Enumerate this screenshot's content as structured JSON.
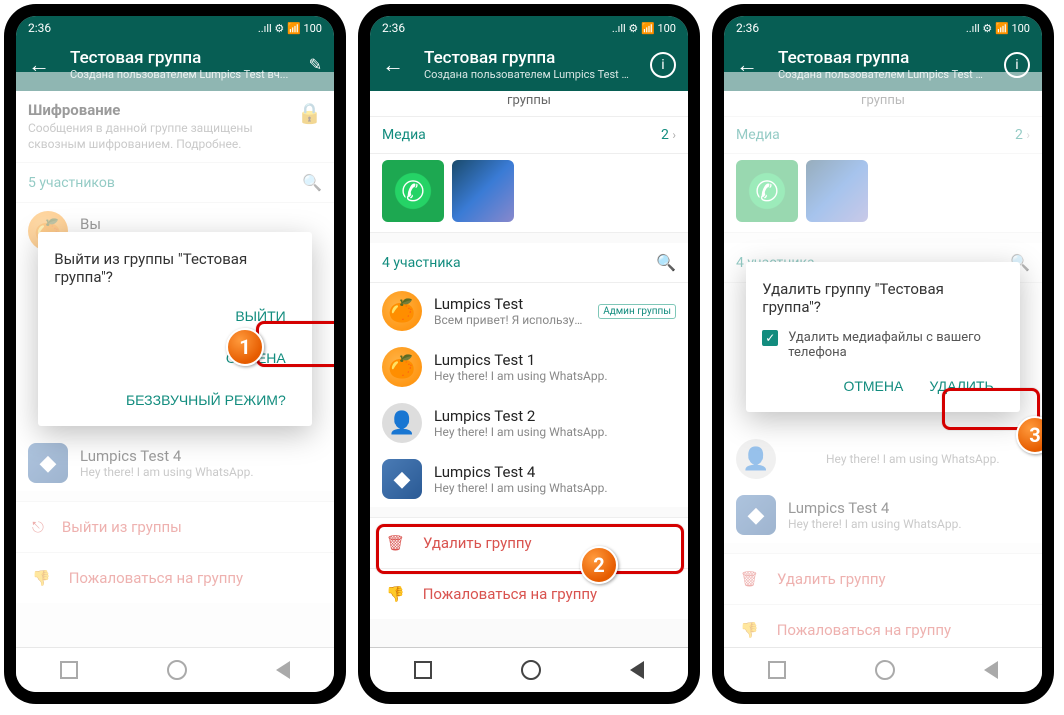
{
  "status": {
    "time": "2:36",
    "icons": "..ıll ⚙ 📶 100"
  },
  "header": {
    "title": "Тестовая группа",
    "subtitle": "Создана пользователем Lumpics Test вч..."
  },
  "partial_top_label": "группы",
  "encryption": {
    "title": "Шифрование",
    "desc": "Сообщения в данной группе защищены сквозным шифрованием. Подробнее."
  },
  "media_label": "Медиа",
  "media_count_1": "2",
  "media_count_2": "2",
  "members_5": "5 участников",
  "members_4": "4 участника",
  "you": {
    "name": "Вы",
    "status": "Hey there! I am using WhatsApp."
  },
  "lumpics_test": {
    "name": "Lumpics Test",
    "status": "Всем привет! Я использую WhatsApp.",
    "badge": "Админ группы"
  },
  "lumpics_test1": {
    "name": "Lumpics Test 1",
    "status": "Hey there! I am using WhatsApp."
  },
  "lumpics_test2": {
    "name": "Lumpics Test 2",
    "status": "Hey there! I am using WhatsApp."
  },
  "lumpics_test4": {
    "name": "Lumpics Test 4",
    "status": "Hey there! I am using WhatsApp."
  },
  "actions": {
    "leave": "Выйти из группы",
    "delete": "Удалить группу",
    "report": "Пожаловаться на группу"
  },
  "dialog1": {
    "title": "Выйти из группы \"Тестовая группа\"?",
    "exit": "ВЫЙТИ",
    "cancel": "ОТМЕНА",
    "silent": "БЕЗЗВУЧНЫЙ РЕЖИМ?"
  },
  "dialog3": {
    "title": "Удалить группу \"Тестовая группа\"?",
    "checkbox": "Удалить медиафайлы с вашего телефона",
    "cancel": "ОТМЕНА",
    "delete": "УДАЛИТЬ"
  },
  "badges": {
    "b1": "1",
    "b2": "2",
    "b3": "3"
  }
}
